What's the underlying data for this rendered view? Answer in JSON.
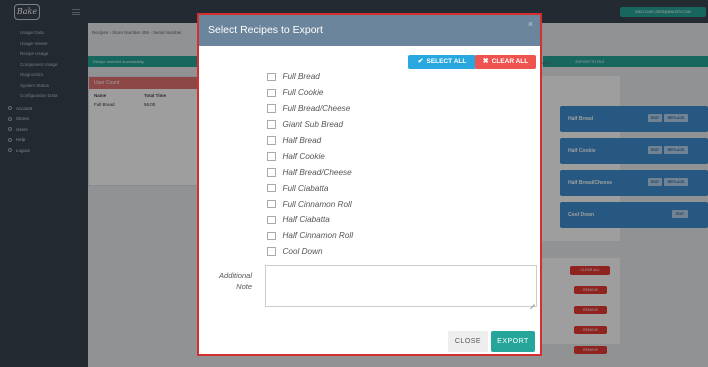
{
  "app": {
    "logo_text": "Bake",
    "welcome": "WELCOME USER@BAKERY.COM"
  },
  "sidebar": {
    "items": [
      {
        "label": "Usage Data",
        "sub": true
      },
      {
        "label": "Usage Viewer",
        "sub": true
      },
      {
        "label": "Recipe Usage",
        "sub": true
      },
      {
        "label": "Component Usage",
        "sub": true
      },
      {
        "label": "Diagnostics",
        "sub": true
      },
      {
        "label": "System Status",
        "sub": true
      },
      {
        "label": "Configuration Data",
        "sub": true
      },
      {
        "label": "Account",
        "sub": false,
        "icon": "user-icon"
      },
      {
        "label": "Stores",
        "sub": false,
        "icon": "store-icon"
      },
      {
        "label": "Users",
        "sub": false,
        "icon": "users-icon"
      },
      {
        "label": "Help",
        "sub": false,
        "icon": "help-icon"
      },
      {
        "label": "Logout",
        "sub": false,
        "icon": "logout-icon"
      }
    ]
  },
  "page": {
    "breadcrumb": "Recipes  ›  Store Number 456 - Serial Number",
    "success_text": "Recipe restored successfully",
    "left_panel_title": "User Count",
    "left_panel_headers": [
      "Name",
      "Total Time"
    ],
    "left_panel_row": [
      "Full Bread",
      "56:00"
    ],
    "tabs": [
      "Page 1",
      "Page 2",
      "Page 3"
    ],
    "export_to_file": "EXPORT TO FILE",
    "recipe_cards": [
      {
        "name": "Half Bread",
        "edit": "EDIT",
        "replace": "REPLACE"
      },
      {
        "name": "Half Cookie",
        "edit": "EDIT",
        "replace": "REPLACE"
      },
      {
        "name": "Half Bread/Cheese",
        "edit": "EDIT",
        "replace": "REPLACE"
      },
      {
        "name": "Cool Down",
        "edit": "EDIT"
      }
    ],
    "clear_all": "CLEAR ALL",
    "remove_label": "REMOVE"
  },
  "modal": {
    "title": "Select Recipes to Export",
    "close_glyph": "×",
    "select_all": "SELECT ALL",
    "clear_all": "CLEAR ALL",
    "recipes": [
      "Full Bread",
      "Full Cookie",
      "Full Bread/Cheese",
      "Giant Sub Bread",
      "Half Bread",
      "Half Cookie",
      "Half Bread/Cheese",
      "Full Ciabatta",
      "Full Cinnamon Roll",
      "Half Ciabatta",
      "Half Cinnamon Roll",
      "Cool Down"
    ],
    "note_label": "Additional Note",
    "note_value": "",
    "close_button": "CLOSE",
    "export_button": "EXPORT"
  },
  "colors": {
    "modal_header": "#6b859c",
    "modal_border": "#d62f2f",
    "select_all": "#29a8e0",
    "clear_all": "#ef5350",
    "export": "#26a69a",
    "recipe_card": "#3e8ed0"
  }
}
